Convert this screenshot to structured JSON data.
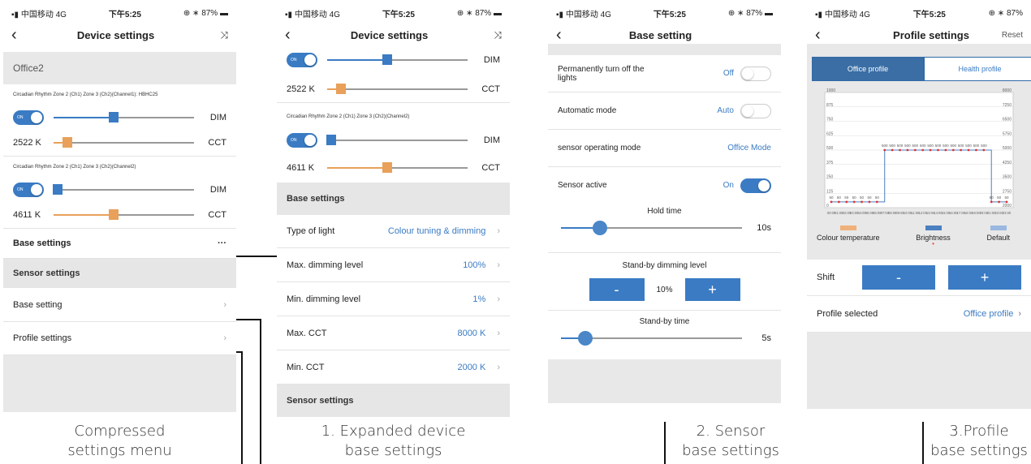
{
  "status": {
    "carrier": "中国移动",
    "network": "4G",
    "time": "下午5:25",
    "battery": "87%"
  },
  "colors": {
    "accent": "#3a7bc4",
    "orange": "#e8a05a",
    "grey_band": "#e8e8e8"
  },
  "p0": {
    "title": "Device settings",
    "group_name": "Office2",
    "zone1_label": "Circadian Rhythm Zone 2 (Ch1) Zone 3 (Ch2)(Channel1): HBHC25",
    "zone2_label": "Circadian Rhythm Zone 2 (Ch1) Zone 3 (Ch2)(Channel2)",
    "on_label": "ON",
    "dim_label": "DIM",
    "cct_label": "CCT",
    "cct1": "2522 K",
    "cct2": "4611 K",
    "base_settings": "Base settings",
    "more": "···",
    "sensor_settings": "Sensor settings",
    "base_setting": "Base setting",
    "profile_settings": "Profile settings",
    "caption_l1": "Compressed",
    "caption_l2": "settings menu",
    "levels": {
      "dim1": 0.43,
      "cct1": 0.1,
      "dim2": 0.03,
      "cct2": 0.43
    }
  },
  "p1": {
    "title": "Device settings",
    "on_label": "ON",
    "dim_label": "DIM",
    "cct_label": "CCT",
    "cct1": "2522 K",
    "cct2": "4611 K",
    "zone2_label": "Circadian Rhythm Zone 2 (Ch1) Zone 3 (Ch2)(Channel2)",
    "base_settings": "Base settings",
    "rows": [
      {
        "label": "Type of light",
        "value": "Colour tuning & dimming"
      },
      {
        "label": "Max. dimming level",
        "value": "100%"
      },
      {
        "label": "Min. dimming level",
        "value": "1%"
      },
      {
        "label": "Max. CCT",
        "value": "8000 K"
      },
      {
        "label": "Min. CCT",
        "value": "2000 K"
      }
    ],
    "sensor_settings": "Sensor settings",
    "caption_l1": "1. Expanded device",
    "caption_l2": "base settings",
    "levels": {
      "dim1": 0.43,
      "cct1": 0.1,
      "dim2": 0.03,
      "cct2": 0.43
    }
  },
  "p2": {
    "title": "Base setting",
    "perm_off_l1": "Permanently turn off the",
    "perm_off_l2": "lights",
    "perm_off_value": "Off",
    "auto_mode": "Automatic mode",
    "auto_value": "Auto",
    "sensor_mode": "sensor operating mode",
    "sensor_mode_value": "Office Mode",
    "sensor_active": "Sensor active",
    "sensor_active_value": "On",
    "hold_time": "Hold time",
    "hold_value": "10s",
    "standby_dim": "Stand-by dimming level",
    "minus": "-",
    "plus": "+",
    "standby_dim_value": "10%",
    "standby_time": "Stand-by time",
    "standby_time_value": "5s",
    "caption_l1": "2. Sensor",
    "caption_l2": "base settings",
    "levels": {
      "hold": 0.2,
      "standby": 0.12
    }
  },
  "p3": {
    "title": "Profile settings",
    "reset": "Reset",
    "tab_office": "Office profile",
    "tab_health": "Health profile",
    "y_left": [
      "1000",
      "875",
      "750",
      "625",
      "500",
      "375",
      "250",
      "125",
      "0"
    ],
    "y_right": [
      "8000",
      "7250",
      "6500",
      "5750",
      "5000",
      "4250",
      "3500",
      "2750",
      "2000"
    ],
    "legend_ct": "Colour temperature",
    "legend_br": "Brightness",
    "legend_df": "Default",
    "shift": "Shift",
    "minus": "-",
    "plus": "+",
    "profile_selected": "Profile selected",
    "profile_value": "Office profile",
    "caption_l1": "3.Profile",
    "caption_l2": "base settings"
  },
  "chart_data": {
    "type": "line",
    "x": [
      "00:00",
      "01:00",
      "02:00",
      "03:00",
      "04:00",
      "05:00",
      "06:00",
      "07:00",
      "08:00",
      "09:00",
      "10:00",
      "11:00",
      "12:00",
      "13:00",
      "14:00",
      "15:00",
      "16:00",
      "17:00",
      "18:00",
      "19:00",
      "20:00",
      "21:00",
      "22:00",
      "23:00"
    ],
    "series": [
      {
        "name": "Brightness",
        "values": [
          50,
          50,
          50,
          50,
          50,
          50,
          50,
          500,
          500,
          500,
          500,
          500,
          500,
          500,
          500,
          500,
          500,
          500,
          500,
          500,
          500,
          50,
          50,
          50
        ]
      }
    ],
    "ylim": [
      0,
      1000
    ],
    "y2lim": [
      2000,
      8000
    ],
    "grid": true
  }
}
